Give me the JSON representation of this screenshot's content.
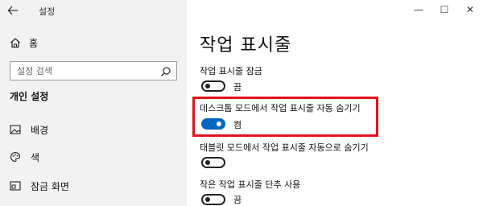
{
  "window": {
    "title": "설정",
    "controls": {
      "minimize": "—",
      "maximize": "☐",
      "close": "✕"
    }
  },
  "sidebar": {
    "home_label": "홈",
    "search_placeholder": "설정 검색",
    "section_title": "개인 설정",
    "items": [
      {
        "label": "배경",
        "icon": "image-icon"
      },
      {
        "label": "색",
        "icon": "palette-icon"
      },
      {
        "label": "잠금 화면",
        "icon": "lock-screen-icon"
      }
    ]
  },
  "main": {
    "title": "작업 표시줄",
    "settings": [
      {
        "label": "작업 표시줄 잠금",
        "state": "끔",
        "on": false
      },
      {
        "label": "데스크톱 모드에서 작업 표시줄 자동 숨기기",
        "state": "켬",
        "on": true,
        "highlighted": true
      },
      {
        "label": "태블릿 모드에서 작업 표시줄 자동으로 숨기기",
        "state": "",
        "on": false
      },
      {
        "label": "작은 작업 표시줄 단추 사용",
        "state": "끔",
        "on": false
      }
    ]
  },
  "colors": {
    "accent": "#0067c0",
    "highlight_box": "#e0131e",
    "sidebar_bg": "#f2f2f2"
  }
}
